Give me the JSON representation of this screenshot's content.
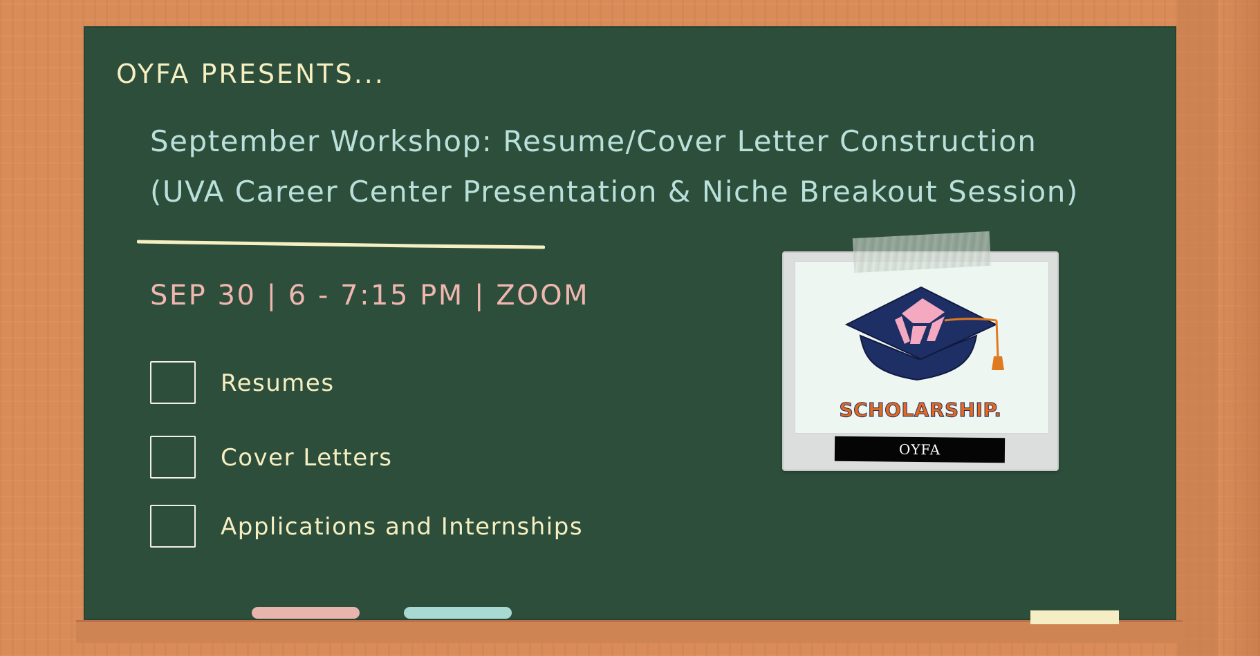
{
  "header": {
    "presents": "OYFA PRESENTS..."
  },
  "workshop": {
    "title_line1": "September Workshop: Resume/Cover Letter Construction",
    "title_line2": "(UVA Career Center Presentation & Niche Breakout Session)",
    "date_line": "SEP 30 | 6 - 7:15 PM | ZOOM"
  },
  "checklist": [
    {
      "label": "Resumes"
    },
    {
      "label": "Cover Letters"
    },
    {
      "label": "Applications and Internships"
    }
  ],
  "photo": {
    "logo_text": "SCHOLARSHIP.",
    "caption": "OYFA"
  },
  "colors": {
    "board": "#2d4e3b",
    "frame": "#d98c58",
    "cream": "#f6efc2",
    "teal": "#b9e0da",
    "pink": "#f0b7b0",
    "cap_navy": "#1e2f66",
    "logo_orange": "#e56a1f"
  },
  "icons": [
    "graduation-cap-icon",
    "checkbox-icon",
    "chalk-stick-icon",
    "tape-icon"
  ]
}
